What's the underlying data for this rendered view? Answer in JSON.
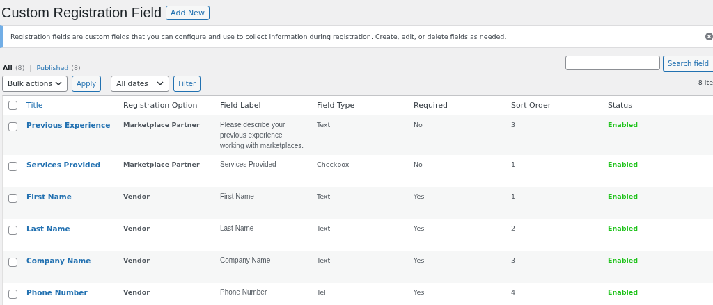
{
  "page_title": "Custom Registration Field",
  "add_new": "Add New",
  "notice": {
    "text": "Registration fields are custom fields that you can configure and use to collect information during registration. Create, edit, or delete fields as needed.",
    "dismissible": true
  },
  "views": [
    {
      "label": "All",
      "count": "(8)",
      "selected": true
    },
    {
      "label": "Published",
      "count": "(8)",
      "selected": false
    }
  ],
  "views_separator": "|",
  "search": {
    "button": "Search field"
  },
  "bulk_actions": {
    "value": "Bulk actions",
    "button": "Apply"
  },
  "date_filter": {
    "value": "All dates",
    "button": "Filter"
  },
  "items_count": "8 ite",
  "table": {
    "select_all": {
      "checked": false
    },
    "columns": [
      "Title",
      "Registration Option",
      "Field Label",
      "Field Type",
      "Required",
      "Sort Order",
      "Status"
    ],
    "rows": [
      {
        "checked": false,
        "title": "Previous Experience",
        "option": "Marketplace Partner",
        "label": "Please describe your previous experience working with marketplaces.",
        "type": "Text",
        "required": "No",
        "sort": "3",
        "status": "Enabled"
      },
      {
        "checked": false,
        "title": "Services Provided",
        "option": "Marketplace Partner",
        "label": "Services Provided",
        "type": "Checkbox",
        "required": "No",
        "sort": "1",
        "status": "Enabled"
      },
      {
        "checked": false,
        "title": "First Name",
        "option": "Vendor",
        "label": "First Name",
        "type": "Text",
        "required": "Yes",
        "sort": "1",
        "status": "Enabled"
      },
      {
        "checked": false,
        "title": "Last Name",
        "option": "Vendor",
        "label": "Last Name",
        "type": "Text",
        "required": "Yes",
        "sort": "2",
        "status": "Enabled"
      },
      {
        "checked": false,
        "title": "Company Name",
        "option": "Vendor",
        "label": "Company Name",
        "type": "Text",
        "required": "Yes",
        "sort": "3",
        "status": "Enabled"
      },
      {
        "checked": false,
        "title": "Phone Number",
        "option": "Vendor",
        "label": "Phone Number",
        "type": "Tel",
        "required": "Yes",
        "sort": "4",
        "status": "Enabled"
      }
    ]
  }
}
